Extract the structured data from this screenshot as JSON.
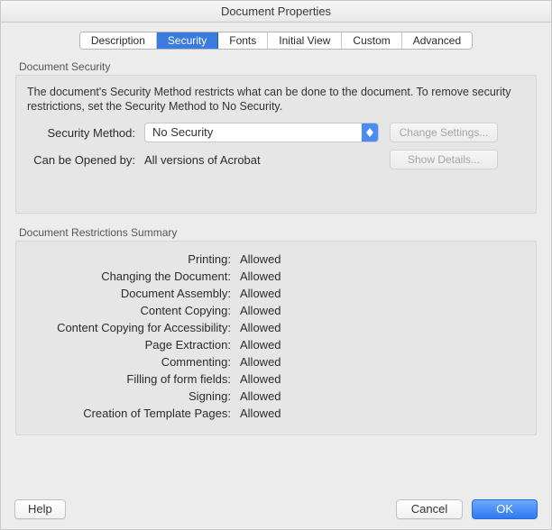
{
  "window": {
    "title": "Document Properties"
  },
  "tabs": {
    "items": [
      "Description",
      "Security",
      "Fonts",
      "Initial View",
      "Custom",
      "Advanced"
    ],
    "selected_index": 1
  },
  "security_group": {
    "title": "Document Security",
    "description": "The document's Security Method restricts what can be done to the document. To remove security restrictions, set the Security Method to No Security.",
    "method_label": "Security Method:",
    "method_value": "No Security",
    "change_settings_label": "Change Settings...",
    "opened_by_label": "Can be Opened by:",
    "opened_by_value": "All versions of Acrobat",
    "show_details_label": "Show Details..."
  },
  "restrictions_group": {
    "title": "Document Restrictions Summary",
    "rows": [
      {
        "label": "Printing:",
        "value": "Allowed"
      },
      {
        "label": "Changing the Document:",
        "value": "Allowed"
      },
      {
        "label": "Document Assembly:",
        "value": "Allowed"
      },
      {
        "label": "Content Copying:",
        "value": "Allowed"
      },
      {
        "label": "Content Copying for Accessibility:",
        "value": "Allowed"
      },
      {
        "label": "Page Extraction:",
        "value": "Allowed"
      },
      {
        "label": "Commenting:",
        "value": "Allowed"
      },
      {
        "label": "Filling of form fields:",
        "value": "Allowed"
      },
      {
        "label": "Signing:",
        "value": "Allowed"
      },
      {
        "label": "Creation of Template Pages:",
        "value": "Allowed"
      }
    ]
  },
  "footer": {
    "help": "Help",
    "cancel": "Cancel",
    "ok": "OK"
  }
}
